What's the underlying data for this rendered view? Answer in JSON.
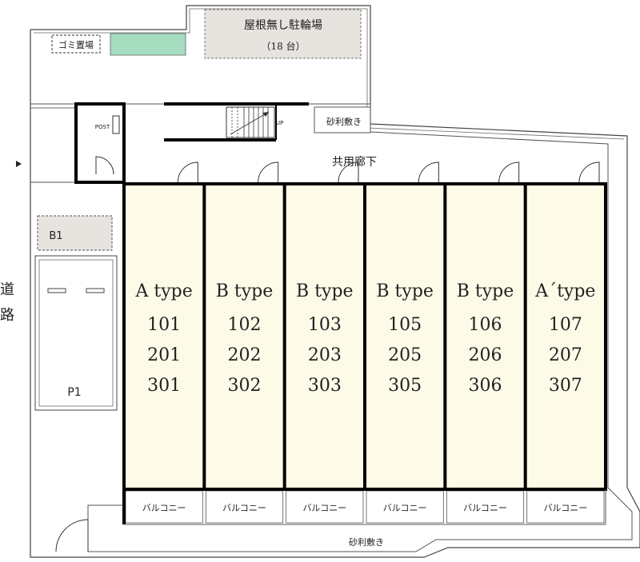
{
  "labels": {
    "bicycle_parking": "屋根無し駐輪場",
    "bicycle_capacity": "（18 台）",
    "garbage": "ゴミ置場",
    "post": "POST",
    "stairs_up": "UP",
    "gravel_top": "砂利敷き",
    "gravel_bottom": "砂利敷き",
    "corridor": "共用廊下",
    "road": "道路",
    "road_char_1": "道",
    "road_char_2": "路",
    "b1": "B1",
    "p1": "P1"
  },
  "units": [
    {
      "type": "A type",
      "rooms": [
        "101",
        "201",
        "301"
      ],
      "balcony": "バルコニー"
    },
    {
      "type": "B type",
      "rooms": [
        "102",
        "202",
        "302"
      ],
      "balcony": "バルコニー"
    },
    {
      "type": "B type",
      "rooms": [
        "103",
        "203",
        "303"
      ],
      "balcony": "バルコニー"
    },
    {
      "type": "B type",
      "rooms": [
        "105",
        "205",
        "305"
      ],
      "balcony": "バルコニー"
    },
    {
      "type": "B type",
      "rooms": [
        "106",
        "206",
        "306"
      ],
      "balcony": "バルコニー"
    },
    {
      "type": "A´type",
      "rooms": [
        "107",
        "207",
        "307"
      ],
      "balcony": "バルコニー"
    }
  ],
  "colors": {
    "unit_fill": "#fdfbe8",
    "green_strip": "#a6dcc0",
    "gray_area": "#e7e3de",
    "wall": "#000000"
  }
}
